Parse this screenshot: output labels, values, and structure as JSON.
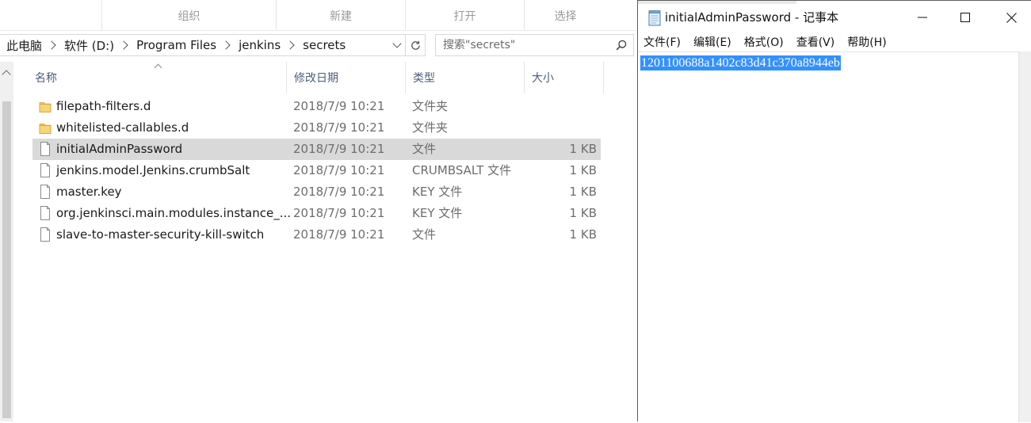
{
  "ribbon": {
    "groups": [
      "组织",
      "新建",
      "打开",
      "选择"
    ]
  },
  "address_bar": {
    "crumbs": [
      "此电脑",
      "软件 (D:)",
      "Program Files",
      "jenkins",
      "secrets"
    ]
  },
  "search": {
    "placeholder": "搜索\"secrets\""
  },
  "columns": {
    "name": "名称",
    "modified": "修改日期",
    "type": "类型",
    "size": "大小"
  },
  "files": [
    {
      "name": "filepath-filters.d",
      "modified": "2018/7/9 10:21",
      "type": "文件夹",
      "size": "",
      "kind": "folder",
      "selected": false
    },
    {
      "name": "whitelisted-callables.d",
      "modified": "2018/7/9 10:21",
      "type": "文件夹",
      "size": "",
      "kind": "folder",
      "selected": false
    },
    {
      "name": "initialAdminPassword",
      "modified": "2018/7/9 10:21",
      "type": "文件",
      "size": "1 KB",
      "kind": "file",
      "selected": true
    },
    {
      "name": "jenkins.model.Jenkins.crumbSalt",
      "modified": "2018/7/9 10:21",
      "type": "CRUMBSALT 文件",
      "size": "1 KB",
      "kind": "file",
      "selected": false
    },
    {
      "name": "master.key",
      "modified": "2018/7/9 10:21",
      "type": "KEY 文件",
      "size": "1 KB",
      "kind": "file",
      "selected": false
    },
    {
      "name": "org.jenkinsci.main.modules.instance_...",
      "modified": "2018/7/9 10:21",
      "type": "KEY 文件",
      "size": "1 KB",
      "kind": "file",
      "selected": false
    },
    {
      "name": "slave-to-master-security-kill-switch",
      "modified": "2018/7/9 10:21",
      "type": "文件",
      "size": "1 KB",
      "kind": "file",
      "selected": false
    }
  ],
  "notepad": {
    "title": "initialAdminPassword - 记事本",
    "menu": [
      "文件(F)",
      "编辑(E)",
      "格式(O)",
      "查看(V)",
      "帮助(H)"
    ],
    "content": "1201100688a1402c83d41c370a8944eb"
  },
  "colors": {
    "selection_row": "#d9d9d9",
    "text_selection": "#3390ff",
    "header_text": "#4c607a",
    "folder": "#f2c65a"
  },
  "icons": {
    "folder": "folder-icon",
    "file": "file-icon",
    "refresh": "refresh-icon",
    "search": "search-icon",
    "notepad": "notepad-icon",
    "minimize": "minimize-icon",
    "maximize": "maximize-icon",
    "close": "close-icon"
  }
}
